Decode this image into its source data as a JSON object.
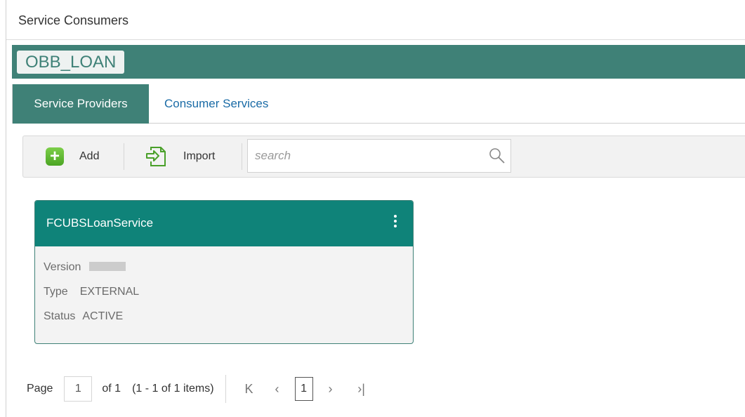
{
  "page": {
    "title": "Service Consumers"
  },
  "consumer": {
    "name": "OBB_LOAN"
  },
  "tabs": [
    {
      "label": "Service Providers",
      "active": true
    },
    {
      "label": "Consumer Services",
      "active": false
    }
  ],
  "toolbar": {
    "add_label": "Add",
    "import_label": "Import",
    "search_placeholder": "search"
  },
  "cards": [
    {
      "title": "FCUBSLoanService",
      "version_label": "Version",
      "version_value": "",
      "type_label": "Type",
      "type_value": "EXTERNAL",
      "status_label": "Status",
      "status_value": "ACTIVE"
    }
  ],
  "pagination": {
    "page_label": "Page",
    "page_value": "1",
    "of_text": "of 1",
    "items_text": "(1 - 1 of 1 items)",
    "first_icon": "K",
    "prev_icon": "‹",
    "current": "1",
    "next_icon": "›",
    "last_icon": "›|"
  },
  "colors": {
    "primary": "#3f8177",
    "card_header": "#0f8379",
    "link": "#1a6ba6"
  }
}
